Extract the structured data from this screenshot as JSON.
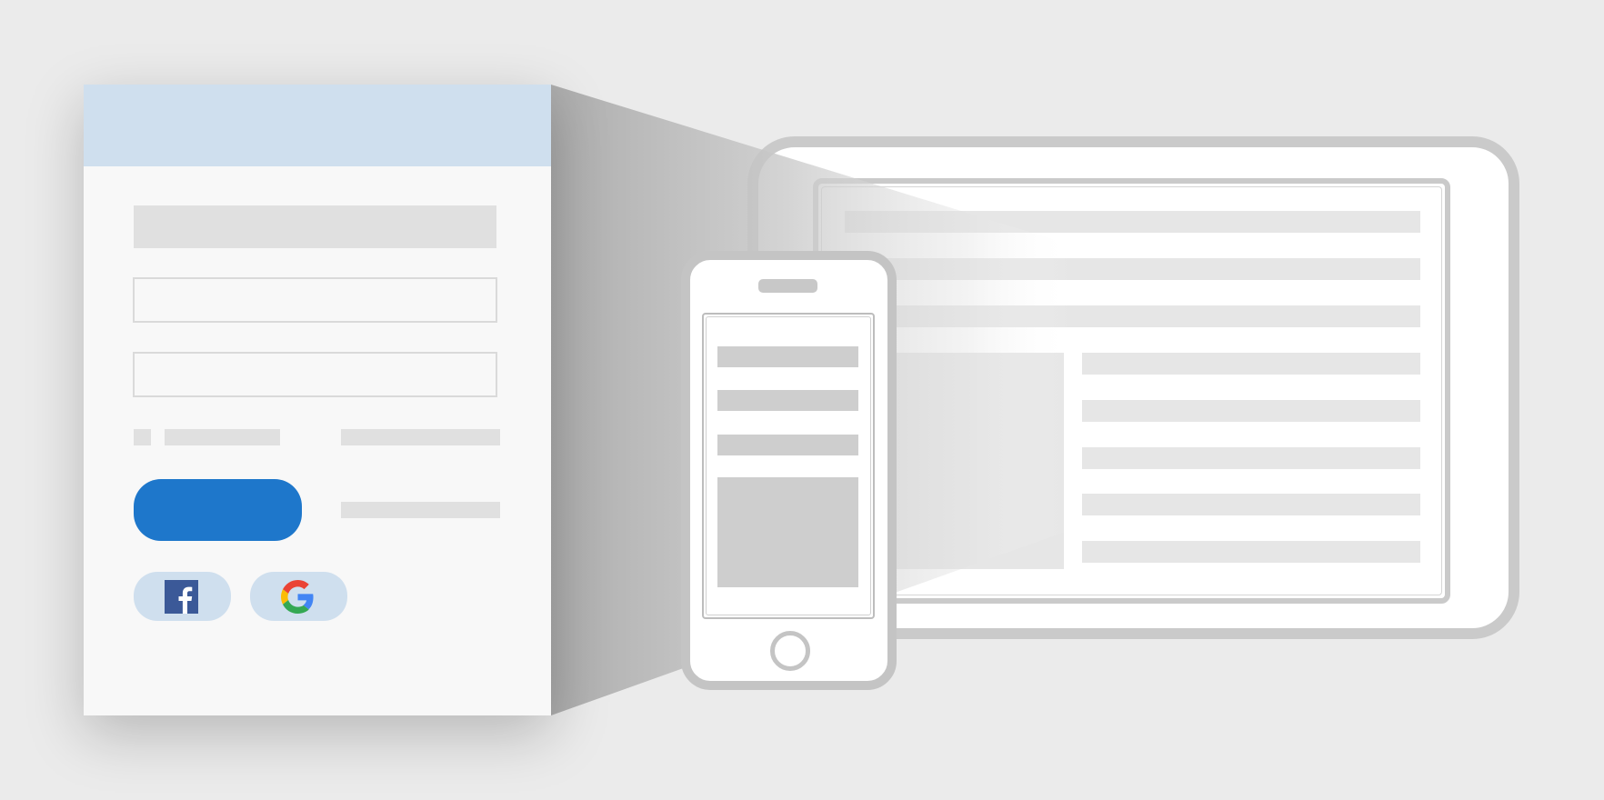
{
  "scene": {
    "description_kind": "responsive-login-illustration",
    "icons": [
      "facebook-icon",
      "google-icon"
    ],
    "colors": {
      "background": "#ebebeb",
      "card_header": "#cfdfee",
      "primary_button": "#1e77cb",
      "device_frame": "#cacaca",
      "placeholder_bar": "#e0e0e0"
    }
  }
}
